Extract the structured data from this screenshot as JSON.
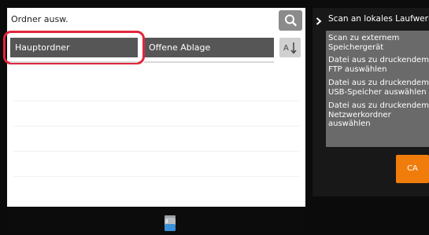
{
  "folder_select": {
    "title": "Ordner ausw.",
    "buttons": [
      {
        "label": "Hauptordner"
      },
      {
        "label": "Offene Ablage"
      }
    ]
  },
  "menu": {
    "items": [
      {
        "label": "Scan an lokales Laufwerk"
      },
      {
        "label": "Scan zu externem\nSpeichergerät"
      },
      {
        "label": "Datei aus zu druckendem\nFTP auswählen"
      },
      {
        "label": "Datei aus zu druckendem\nUSB-Speicher auswählen"
      },
      {
        "label": "Datei aus zu druckendem\nNetzwerkordner auswählen"
      }
    ]
  },
  "actions": {
    "ca_label": "CA"
  },
  "colors": {
    "highlight": "#e0263d",
    "accent_orange": "#f07d0b",
    "button_dark": "#565656",
    "menu_bg": "#6a6a6a"
  },
  "icons": [
    "search-icon",
    "sort-icon",
    "chevron-right-icon",
    "trash-icon"
  ]
}
